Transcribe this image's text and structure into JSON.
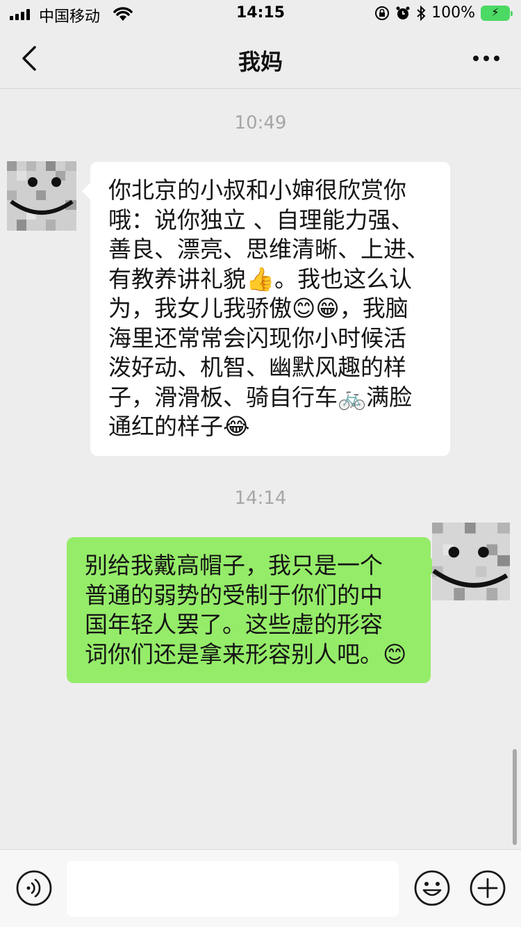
{
  "status_bar": {
    "carrier": "中国移动",
    "time": "14:15",
    "battery_percent": "100%"
  },
  "nav": {
    "title": "我妈"
  },
  "messages": [
    {
      "timestamp": "10:49",
      "sender": "mother",
      "direction": "incoming",
      "lines": [
        "你北京的小叔和小婶很欣赏你",
        "哦：说你独立 、自理能力强、",
        "善良、漂亮、思维清晰、上进、",
        "有教养讲礼貌👍。我也这么认",
        "为，我女儿我骄傲😊😁，我脑",
        "海里还常常会闪现你小时候活",
        "泼好动、机智、幽默风趣的样",
        "子，滑滑板、骑自行车🚲满脸",
        "通红的样子😂"
      ]
    },
    {
      "timestamp": "14:14",
      "sender": "me",
      "direction": "outgoing",
      "lines": [
        "别给我戴高帽子，我只是一个",
        "普通的弱势的受制于你们的中",
        "国年轻人罢了。这些虚的形容",
        "词你们还是拿来形容别人吧。😊"
      ]
    }
  ],
  "input": {
    "placeholder": ""
  },
  "icons": {
    "back": "chevron-left-icon",
    "more": "more-dots-icon",
    "voice": "voice-icon",
    "emoji": "emoji-icon",
    "plus": "plus-icon"
  },
  "colors": {
    "background": "#ededed",
    "incoming_bubble": "#ffffff",
    "outgoing_bubble": "#95ec69",
    "timestamp": "#a6a6a6"
  }
}
